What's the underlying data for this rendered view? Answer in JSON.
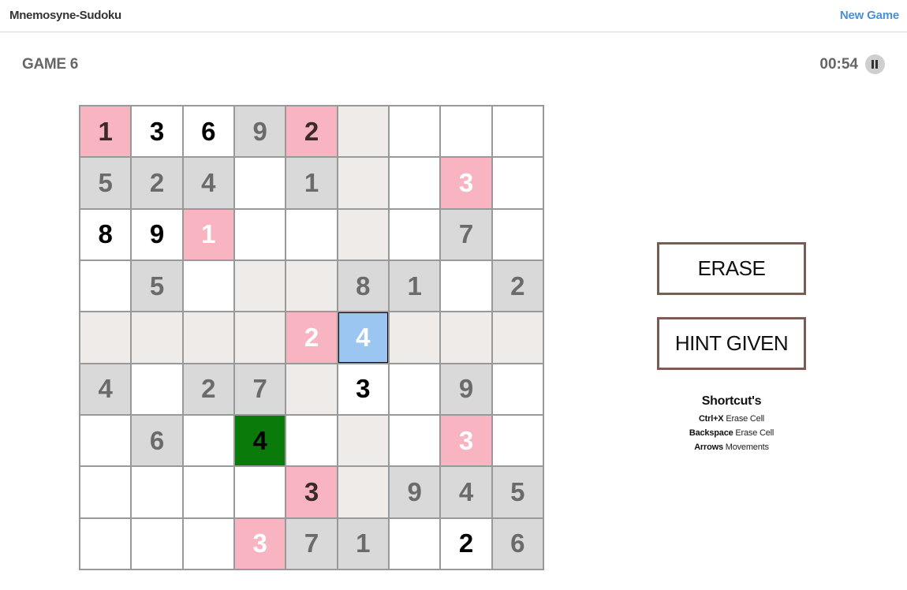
{
  "header": {
    "app_title": "Mnemosyne-Sudoku",
    "new_game_label": "New Game"
  },
  "game": {
    "label": "GAME 6",
    "timer": "00:54",
    "pause_icon": "pause-icon"
  },
  "board": {
    "rows": [
      [
        {
          "v": "1",
          "s": "pink dark"
        },
        {
          "v": "3",
          "s": "white"
        },
        {
          "v": "6",
          "s": "white"
        },
        {
          "v": "9",
          "s": "gray"
        },
        {
          "v": "2",
          "s": "pink dark"
        },
        {
          "v": "",
          "s": "beige"
        },
        {
          "v": "",
          "s": "white"
        },
        {
          "v": "",
          "s": "white"
        },
        {
          "v": "",
          "s": "white"
        }
      ],
      [
        {
          "v": "5",
          "s": "gray"
        },
        {
          "v": "2",
          "s": "gray"
        },
        {
          "v": "4",
          "s": "gray"
        },
        {
          "v": "",
          "s": "white"
        },
        {
          "v": "1",
          "s": "gray"
        },
        {
          "v": "",
          "s": "beige"
        },
        {
          "v": "",
          "s": "white"
        },
        {
          "v": "3",
          "s": "pink"
        },
        {
          "v": "",
          "s": "white"
        }
      ],
      [
        {
          "v": "8",
          "s": "white"
        },
        {
          "v": "9",
          "s": "white"
        },
        {
          "v": "1",
          "s": "pink"
        },
        {
          "v": "",
          "s": "white"
        },
        {
          "v": "",
          "s": "white"
        },
        {
          "v": "",
          "s": "beige"
        },
        {
          "v": "",
          "s": "white"
        },
        {
          "v": "7",
          "s": "gray"
        },
        {
          "v": "",
          "s": "white"
        }
      ],
      [
        {
          "v": "",
          "s": "white"
        },
        {
          "v": "5",
          "s": "gray"
        },
        {
          "v": "",
          "s": "white"
        },
        {
          "v": "",
          "s": "beige"
        },
        {
          "v": "",
          "s": "beige"
        },
        {
          "v": "8",
          "s": "gray"
        },
        {
          "v": "1",
          "s": "gray"
        },
        {
          "v": "",
          "s": "white"
        },
        {
          "v": "2",
          "s": "gray"
        }
      ],
      [
        {
          "v": "",
          "s": "beige"
        },
        {
          "v": "",
          "s": "beige"
        },
        {
          "v": "",
          "s": "beige"
        },
        {
          "v": "",
          "s": "beige"
        },
        {
          "v": "2",
          "s": "pink"
        },
        {
          "v": "4",
          "s": "blue"
        },
        {
          "v": "",
          "s": "beige"
        },
        {
          "v": "",
          "s": "beige"
        },
        {
          "v": "",
          "s": "beige"
        }
      ],
      [
        {
          "v": "4",
          "s": "gray"
        },
        {
          "v": "",
          "s": "white"
        },
        {
          "v": "2",
          "s": "gray"
        },
        {
          "v": "7",
          "s": "gray"
        },
        {
          "v": "",
          "s": "beige"
        },
        {
          "v": "3",
          "s": "white"
        },
        {
          "v": "",
          "s": "white"
        },
        {
          "v": "9",
          "s": "gray"
        },
        {
          "v": "",
          "s": "white"
        }
      ],
      [
        {
          "v": "",
          "s": "white"
        },
        {
          "v": "6",
          "s": "gray"
        },
        {
          "v": "",
          "s": "white"
        },
        {
          "v": "4",
          "s": "green"
        },
        {
          "v": "",
          "s": "white"
        },
        {
          "v": "",
          "s": "beige"
        },
        {
          "v": "",
          "s": "white"
        },
        {
          "v": "3",
          "s": "pink"
        },
        {
          "v": "",
          "s": "white"
        }
      ],
      [
        {
          "v": "",
          "s": "white"
        },
        {
          "v": "",
          "s": "white"
        },
        {
          "v": "",
          "s": "white"
        },
        {
          "v": "",
          "s": "white"
        },
        {
          "v": "3",
          "s": "pink dark"
        },
        {
          "v": "",
          "s": "beige"
        },
        {
          "v": "9",
          "s": "gray"
        },
        {
          "v": "4",
          "s": "gray"
        },
        {
          "v": "5",
          "s": "gray"
        }
      ],
      [
        {
          "v": "",
          "s": "white"
        },
        {
          "v": "",
          "s": "white"
        },
        {
          "v": "",
          "s": "white"
        },
        {
          "v": "3",
          "s": "pink"
        },
        {
          "v": "7",
          "s": "gray"
        },
        {
          "v": "1",
          "s": "gray"
        },
        {
          "v": "",
          "s": "white"
        },
        {
          "v": "2",
          "s": "white"
        },
        {
          "v": "6",
          "s": "gray"
        }
      ]
    ]
  },
  "actions": {
    "erase_label": "ERASE",
    "hint_label": "HINT GIVEN"
  },
  "shortcuts": {
    "title": "Shortcut's",
    "items": [
      {
        "key": "Ctrl+X",
        "desc": "Erase Cell"
      },
      {
        "key": "Backspace",
        "desc": "Erase Cell"
      },
      {
        "key": "Arrows",
        "desc": "Movements"
      }
    ]
  },
  "colors": {
    "accent_link": "#4a90d9",
    "button_border": "#7a5c52",
    "cell_gray": "#d9d9d9",
    "cell_beige": "#efebe9",
    "cell_pink": "#f8b4c1",
    "cell_selected": "#9cc6f2",
    "cell_green": "#0a7a0a"
  }
}
